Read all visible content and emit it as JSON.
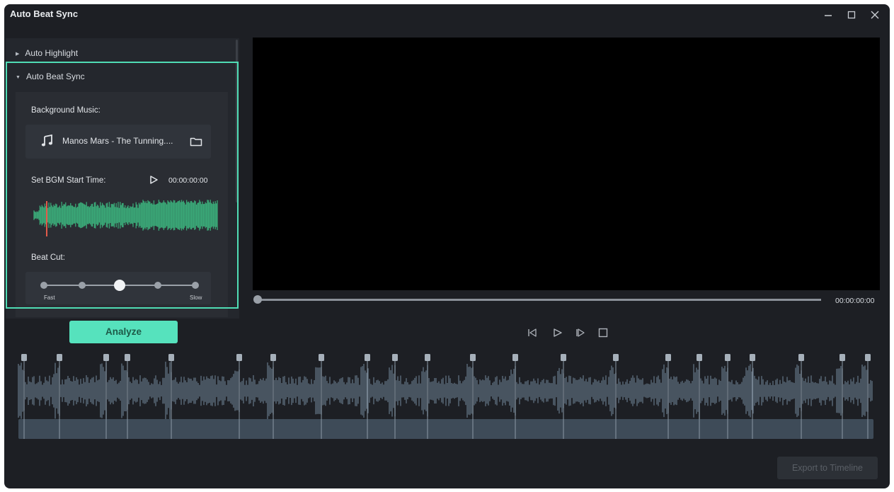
{
  "window": {
    "title": "Auto Beat Sync"
  },
  "sidebar": {
    "sections": [
      {
        "label": "Auto Highlight",
        "expanded": false
      },
      {
        "label": "Auto Beat Sync",
        "expanded": true
      }
    ],
    "background_music_label": "Background Music:",
    "music_name": "Manos Mars - The Tunning....",
    "bgm_start_label": "Set BGM Start Time:",
    "bgm_start_time": "00:00:00:00",
    "beat_cut_label": "Beat Cut:",
    "beat_cut_fast": "Fast",
    "beat_cut_slow": "Slow",
    "beat_cut_level": 3,
    "beat_cut_steps": 5
  },
  "actions": {
    "analyze_label": "Analyze",
    "export_label": "Export to Timeline"
  },
  "player": {
    "timecode": "00:00:00:00"
  },
  "colors": {
    "accent": "#56e2bd",
    "highlight_border": "#4fdcb4",
    "waveform_green": "#3aa877",
    "playhead": "#e25b4b",
    "background": "#1d1f24"
  },
  "icons": {
    "minimize": "minimize-icon",
    "maximize": "maximize-icon",
    "close": "close-icon",
    "music": "music-note-icon",
    "folder": "folder-icon",
    "play": "play-icon",
    "prev_frame": "prev-frame-icon",
    "next_frame": "next-frame-icon",
    "stop": "stop-icon"
  }
}
